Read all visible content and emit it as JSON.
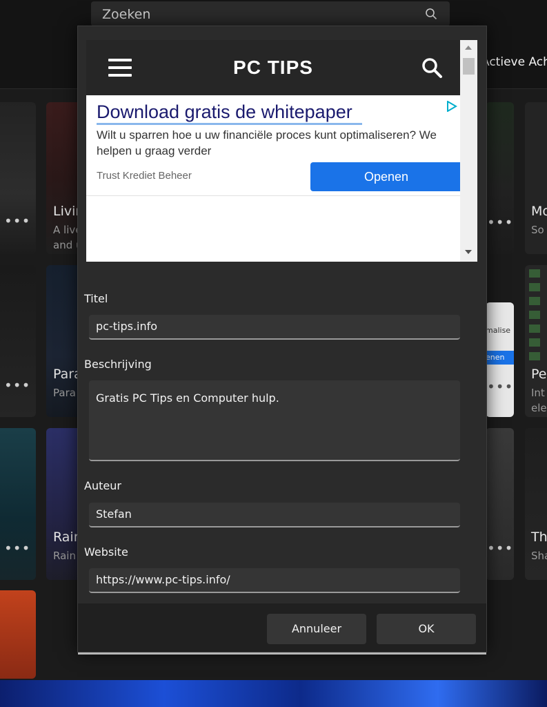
{
  "background": {
    "search": {
      "placeholder": "Zoeken"
    },
    "active_label": "Actieve Acht",
    "tiles": [
      {
        "title": "Livin",
        "subtitle": "A live\nand u"
      },
      {
        "title": "Para",
        "subtitle": "Para"
      },
      {
        "title": "Rain",
        "subtitle": "Rain"
      },
      {
        "title": "Mo",
        "subtitle": "So"
      },
      {
        "title": "Pe",
        "subtitle": "Int\nele"
      },
      {
        "title": "Th",
        "subtitle": "Sha"
      },
      {
        "title": "",
        "subtitle": "malise"
      },
      {
        "title": "",
        "subtitle": "enen"
      }
    ],
    "more_label": "•••"
  },
  "dialog": {
    "preview": {
      "site_title": "PC TIPS",
      "ad": {
        "headline": "Download gratis de whitepaper",
        "body": "Wilt u sparren hoe u uw financiële proces kunt optimaliseren? We helpen u graag verder",
        "advertiser": "Trust Krediet Beheer",
        "button": "Openen"
      }
    },
    "fields": {
      "title": {
        "label": "Titel",
        "value": "pc-tips.info"
      },
      "description": {
        "label": "Beschrijving",
        "value": "Gratis PC Tips en Computer hulp."
      },
      "author": {
        "label": "Auteur",
        "value": "Stefan"
      },
      "website": {
        "label": "Website",
        "value": "https://www.pc-tips.info/"
      }
    },
    "buttons": {
      "cancel": "Annuleer",
      "ok": "OK"
    }
  },
  "colors": {
    "accent": "#1a73e8",
    "dialog_bg": "#2b2b2b",
    "field_bg": "#353535"
  }
}
